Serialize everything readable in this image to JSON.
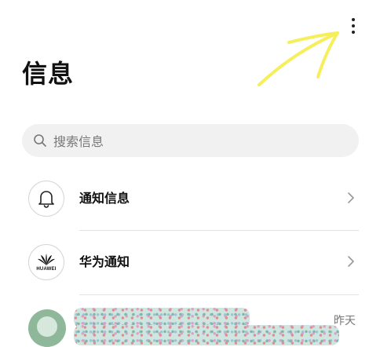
{
  "header": {
    "title": "信息",
    "more_icon": "more-vertical-icon"
  },
  "search": {
    "placeholder": "搜索信息",
    "icon": "search-icon"
  },
  "conversations": [
    {
      "title": "通知信息",
      "icon": "bell-icon"
    },
    {
      "title": "华为通知",
      "icon": "huawei-logo-icon",
      "logo_text": "HUAWEI"
    },
    {
      "time": "昨天",
      "icon": "contact-avatar"
    }
  ],
  "colors": {
    "background": "#ffffff",
    "search_background": "#f1f1f1",
    "divider": "#e3e3e3",
    "secondary_text": "#777777",
    "annotation": "#f7ef5a"
  }
}
